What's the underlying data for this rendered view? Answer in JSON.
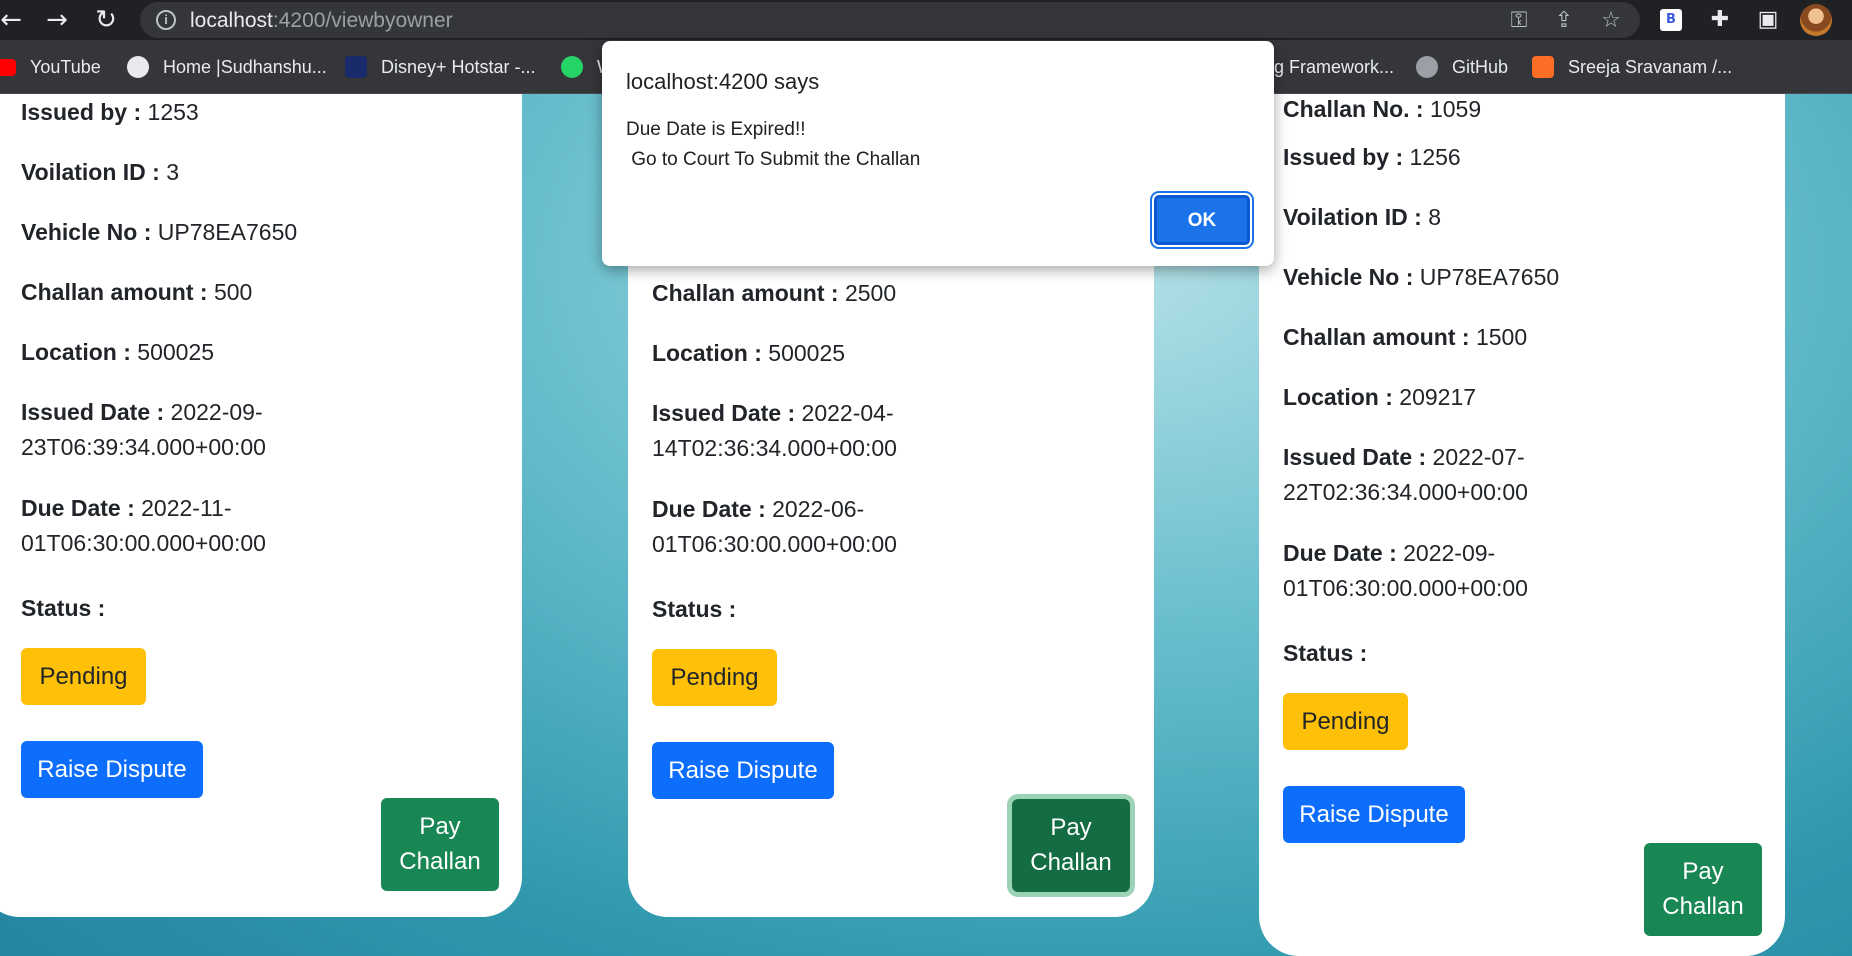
{
  "browser": {
    "url_host": "localhost",
    "url_rest": ":4200/viewbyowner",
    "bookmarks": [
      {
        "label": "YouTube",
        "color": "#ff0000"
      },
      {
        "label": "Home |Sudhanshu...",
        "color": "#e8eaed"
      },
      {
        "label": "Disney+ Hotstar -...",
        "color": "#1a2b6b"
      },
      {
        "label": "W",
        "color": "#25d366"
      },
      {
        "label": "g Framework...",
        "color": ""
      },
      {
        "label": "GitHub",
        "color": "#9aa0a6"
      },
      {
        "label": "Sreeja Sravanam /...",
        "color": "#fc6d26"
      }
    ],
    "ext_b_label": "B"
  },
  "dialog": {
    "title": "localhost:4200 says",
    "message": "Due Date is Expired!!\n Go to Court To Submit the Challan",
    "ok_label": "OK"
  },
  "labels": {
    "challan_no": "Challan No. :",
    "issued_by": "Issued by :",
    "violation_id": "Voilation ID :",
    "vehicle_no": "Vehicle No :",
    "challan_amount": "Challan amount :",
    "location": "Location :",
    "issued_date": "Issued Date :",
    "due_date": "Due Date :",
    "status": "Status :",
    "pending": "Pending",
    "raise_dispute": "Raise Dispute",
    "pay_line1": "Pay",
    "pay_line2": "Challan"
  },
  "cards": [
    {
      "issued_by": "1253",
      "violation_id": "3",
      "vehicle_no": "UP78EA7650",
      "challan_amount": "500",
      "location": "500025",
      "issued_date_1": "2022-09-",
      "issued_date_2": "23T06:39:34.000+00:00",
      "due_date_1": "2022-11-",
      "due_date_2": "01T06:30:00.000+00:00"
    },
    {
      "challan_amount": "2500",
      "location": "500025",
      "issued_date_1": "2022-04-",
      "issued_date_2": "14T02:36:34.000+00:00",
      "due_date_1": "2022-06-",
      "due_date_2": "01T06:30:00.000+00:00"
    },
    {
      "challan_no": "1059",
      "issued_by": "1256",
      "violation_id": "8",
      "vehicle_no": "UP78EA7650",
      "challan_amount": "1500",
      "location": "209217",
      "issued_date_1": "2022-07-",
      "issued_date_2": "22T02:36:34.000+00:00",
      "due_date_1": "2022-09-",
      "due_date_2": "01T06:30:00.000+00:00"
    }
  ]
}
